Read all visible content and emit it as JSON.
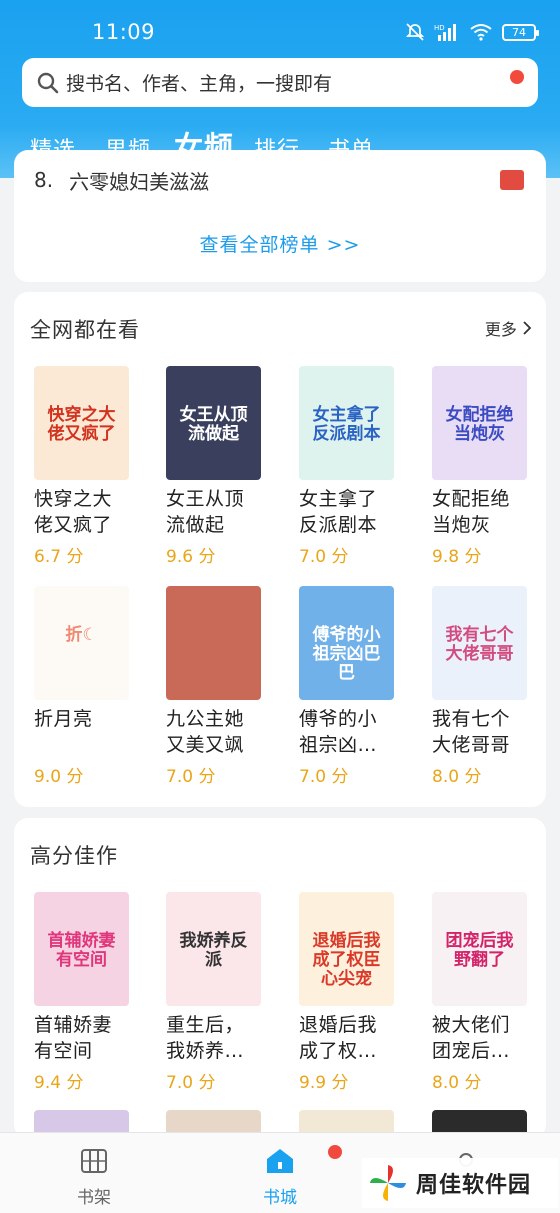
{
  "status_bar": {
    "time": "11:09",
    "battery": "74"
  },
  "search": {
    "placeholder": "搜书名、作者、主角，一搜即有"
  },
  "tabs": [
    {
      "label": "精选",
      "active": false
    },
    {
      "label": "男频",
      "active": false
    },
    {
      "label": "女频",
      "active": true
    },
    {
      "label": "排行",
      "active": false
    },
    {
      "label": "书单",
      "active": false
    }
  ],
  "ranking": {
    "partial_item": {
      "num": "8.",
      "title": "六零媳妇美滋滋"
    },
    "view_all": "查看全部榜单 >>"
  },
  "section_most_read": {
    "title": "全网都在看",
    "more": "更多",
    "books": [
      {
        "title_line1": "快穿之大",
        "title_line2": "佬又疯了",
        "score": "6.7 分",
        "cover_text": "快穿之大佬又疯了",
        "cover_bg": "#fbe9d6",
        "cover_fg": "#d2331f"
      },
      {
        "title_line1": "女王从顶",
        "title_line2": "流做起",
        "score": "9.6 分",
        "cover_text": "女王从顶流做起",
        "cover_bg": "#3a3f5e",
        "cover_fg": "#ffffff"
      },
      {
        "title_line1": "女主拿了",
        "title_line2": "反派剧本",
        "score": "7.0 分",
        "cover_text": "女主拿了反派剧本",
        "cover_bg": "#dff3ee",
        "cover_fg": "#2a63c4"
      },
      {
        "title_line1": "女配拒绝",
        "title_line2": "当炮灰",
        "score": "9.8 分",
        "cover_text": "女配拒绝当炮灰",
        "cover_bg": "#e9dcf5",
        "cover_fg": "#3b4cc2"
      },
      {
        "title_line1": "折月亮",
        "title_line2": "",
        "score": "9.0 分",
        "cover_text": "折☾",
        "cover_bg": "#fdfaf6",
        "cover_fg": "#f08a72"
      },
      {
        "title_line1": "九公主她",
        "title_line2": "又美又飒",
        "score": "7.0 分",
        "cover_text": "",
        "cover_bg": "#c96a58",
        "cover_fg": "#ffffff"
      },
      {
        "title_line1": "傅爷的小",
        "title_line2": "祖宗凶…",
        "score": "7.0 分",
        "cover_text": "傅爷的小祖宗凶巴巴",
        "cover_bg": "#6fb1e8",
        "cover_fg": "#ffffff"
      },
      {
        "title_line1": "我有七个",
        "title_line2": "大佬哥哥",
        "score": "8.0 分",
        "cover_text": "我有七个大佬哥哥",
        "cover_bg": "#eaf1fb",
        "cover_fg": "#d24c7f"
      }
    ]
  },
  "section_high_score": {
    "title": "高分佳作",
    "books": [
      {
        "title_line1": "首辅娇妻",
        "title_line2": "有空间",
        "score": "9.4 分",
        "cover_text": "首辅娇妻有空间",
        "cover_bg": "#f6d3e2",
        "cover_fg": "#e0367c"
      },
      {
        "title_line1": "重生后，",
        "title_line2": "我娇养…",
        "score": "7.0 分",
        "cover_text": "我娇养反派",
        "cover_bg": "#fbe6ea",
        "cover_fg": "#333333"
      },
      {
        "title_line1": "退婚后我",
        "title_line2": "成了权…",
        "score": "9.9 分",
        "cover_text": "退婚后我成了权臣心尖宠",
        "cover_bg": "#fdf0dd",
        "cover_fg": "#d93a2a"
      },
      {
        "title_line1": "被大佬们",
        "title_line2": "团宠后…",
        "score": "8.0 分",
        "cover_text": "团宠后我野翻了",
        "cover_bg": "#f7f1f4",
        "cover_fg": "#d3246a"
      }
    ]
  },
  "bottom_nav": [
    {
      "label": "书架",
      "icon": "bookshelf-icon",
      "active": false
    },
    {
      "label": "书城",
      "icon": "home-icon",
      "active": true
    },
    {
      "label": "",
      "icon": "profile-icon",
      "active": false
    }
  ],
  "watermark": {
    "text": "周佳软件园"
  },
  "colors": {
    "accent": "#1aa1ef",
    "score": "#e9a61a",
    "badge_red": "#f24a3d"
  }
}
